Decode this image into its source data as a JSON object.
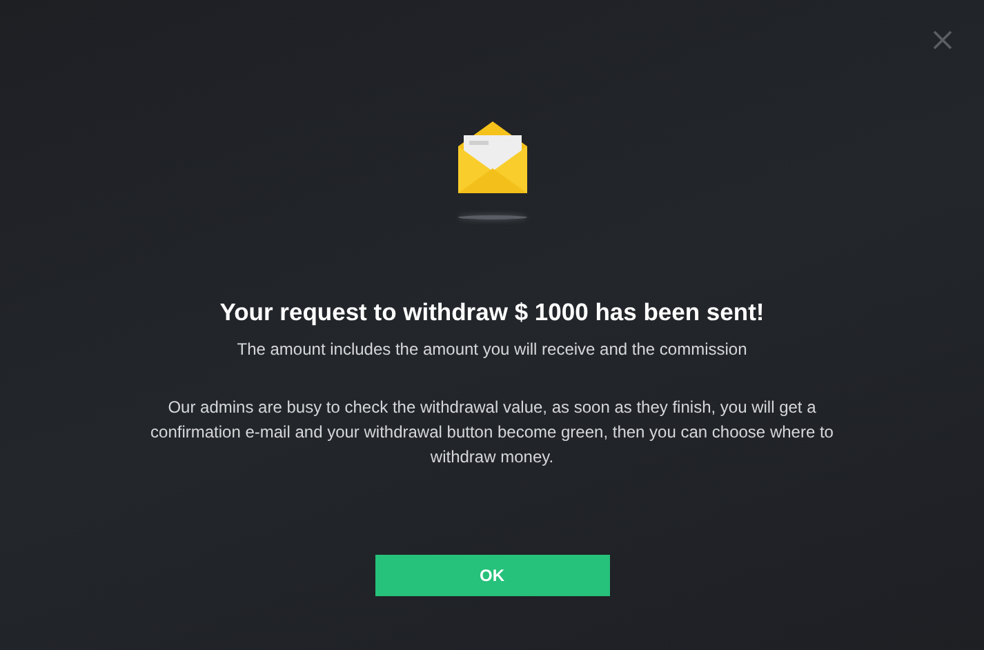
{
  "dialog": {
    "title": "Your request to withdraw $ 1000 has been sent!",
    "subtitle": "The amount includes the amount you will receive and the commission",
    "message": "Our admins are busy to check the withdrawal value, as soon as they finish, you will get a confirmation e-mail and your withdrawal button become green, then you can choose where to withdraw money.",
    "button": "OK"
  }
}
